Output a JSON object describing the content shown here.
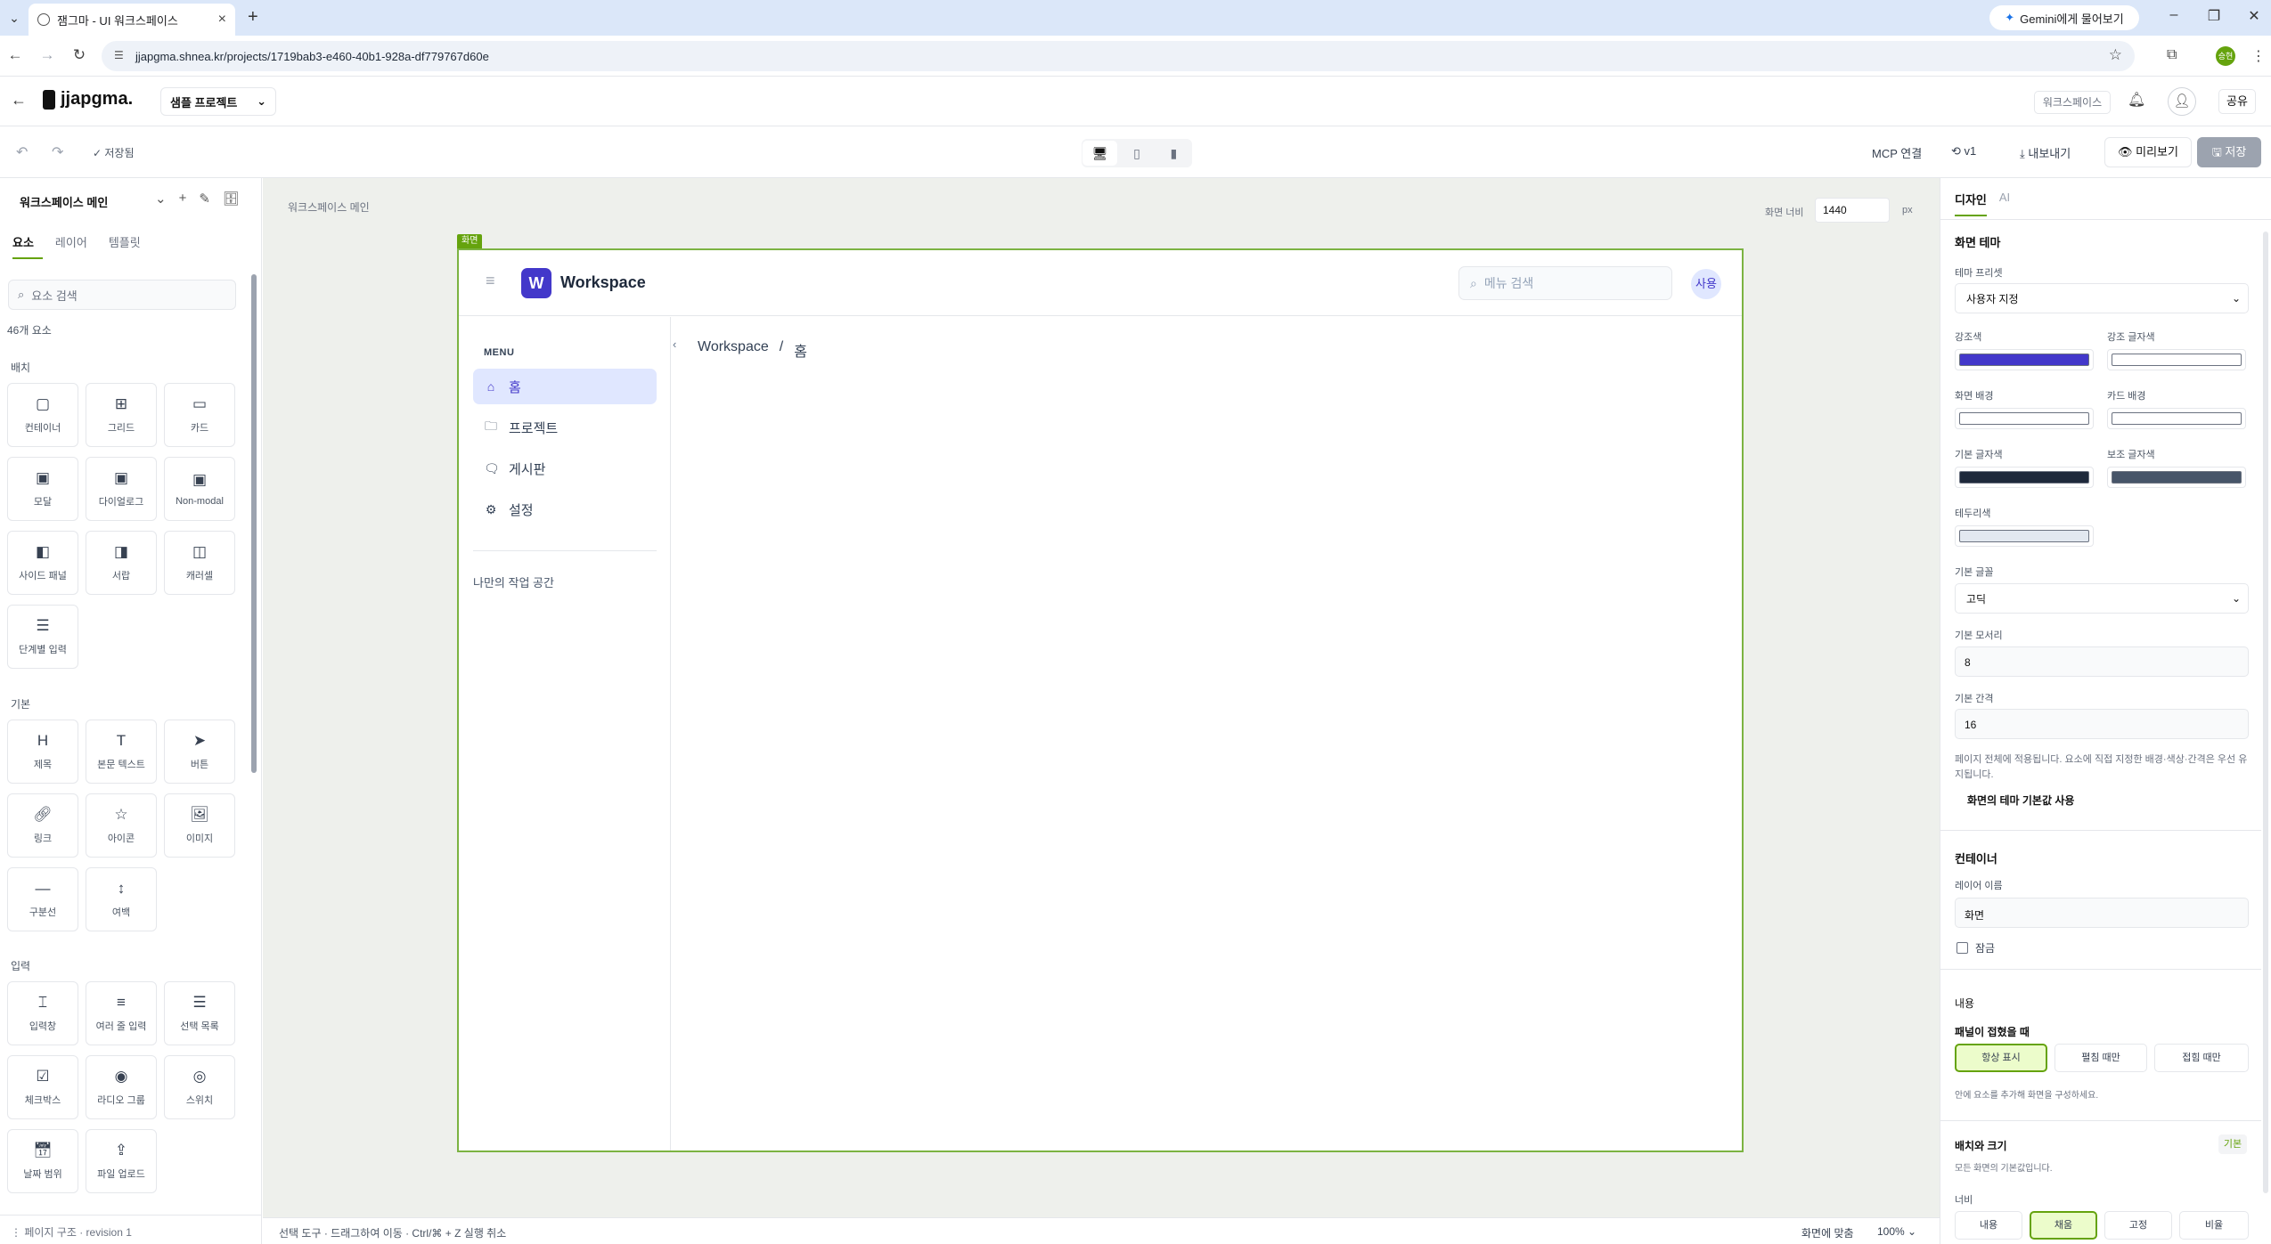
{
  "browser": {
    "tab_title": "잼그마 - UI 워크스페이스",
    "gemini_label": "Gemini에게 물어보기",
    "url": "jjapgma.shnea.kr/projects/1719bab3-e460-40b1-928a-df779767d60e",
    "profile_label": "승현"
  },
  "header": {
    "logo_text": "jjapgma.",
    "project": "샘플 프로젝트",
    "workspace_btn": "워크스페이스",
    "share": "공유"
  },
  "toolbar": {
    "saved": "✓ 저장됨",
    "mcp": "MCP 연결",
    "version": "v1",
    "export": "내보내기",
    "preview": "미리보기",
    "save": "저장"
  },
  "left_panel": {
    "title": "워크스페이스 메인",
    "tabs": [
      "요소",
      "레이어",
      "템플릿"
    ],
    "search_placeholder": "요소 검색",
    "count": "46개 요소",
    "sections": {
      "layout": "배치",
      "basic": "기본",
      "input": "입력"
    },
    "layout_items": [
      "컨테이너",
      "그리드",
      "카드",
      "모달",
      "다이얼로그",
      "Non-modal",
      "사이드 패널",
      "서랍",
      "캐러셀",
      "단계별 입력"
    ],
    "basic_items": [
      "제목",
      "본문 텍스트",
      "버튼",
      "링크",
      "아이콘",
      "이미지",
      "구분선",
      "여백"
    ],
    "input_items": [
      "입력창",
      "여러 줄 입력",
      "선택 목록",
      "체크박스",
      "라디오 그룹",
      "스위치",
      "날짜 범위",
      "파일 업로드"
    ],
    "footer": "페이지 구조 · revision 1"
  },
  "canvas": {
    "label": "워크스페이스 메인",
    "width_label": "화면 너비",
    "width_value": "1440",
    "px": "px",
    "frame_tag": "화면",
    "status_hint": "선택 도구 · 드래그하여 이동 · Ctrl/⌘ + Z 실행 취소",
    "fit": "화면에 맞춤",
    "zoom": "100%"
  },
  "frame": {
    "logo_letter": "W",
    "brand": "Workspace",
    "search_placeholder": "메뉴 검색",
    "avatar": "사용",
    "menu_title": "MENU",
    "menu": [
      "홈",
      "프로젝트",
      "게시판",
      "설정"
    ],
    "my_work": "나만의 작업 공간",
    "breadcrumb": [
      "Workspace",
      "/",
      "홈"
    ]
  },
  "right_panel": {
    "tabs": [
      "디자인",
      "AI"
    ],
    "theme_title": "화면 테마",
    "preset_label": "테마 프리셋",
    "preset_value": "사용자 지정",
    "colors": [
      {
        "label": "강조색",
        "hex": "#4338ca"
      },
      {
        "label": "강조 글자색",
        "hex": "#ffffff"
      },
      {
        "label": "화면 배경",
        "hex": "#ffffff"
      },
      {
        "label": "카드 배경",
        "hex": "#ffffff"
      },
      {
        "label": "기본 글자색",
        "hex": "#1e293b"
      },
      {
        "label": "보조 글자색",
        "hex": "#475569"
      },
      {
        "label": "테두리색",
        "hex": "#e2e8f0"
      }
    ],
    "font_label": "기본 글꼴",
    "font_value": "고딕",
    "radius_label": "기본 모서리",
    "radius_value": "8",
    "spacing_label": "기본 간격",
    "spacing_value": "16",
    "theme_note": "페이지 전체에 적용됩니다. 요소에 직접 지정한 배경·색상·간격은 우선 유지됩니다.",
    "theme_default": "화면의 테마 기본값 사용",
    "container_title": "컨테이너",
    "layer_name_label": "레이어 이름",
    "layer_name_value": "화면",
    "lock_label": "잠금",
    "content_title": "내용",
    "collapse_label": "패널이 접혔을 때",
    "collapse_opts": [
      "항상 표시",
      "펼침 때만",
      "접힘 때만"
    ],
    "content_note": "안에 요소를 추가해 화면을 구성하세요.",
    "size_title": "배치와 크기",
    "size_badge": "기본",
    "size_note": "모든 화면의 기본값입니다.",
    "width_label": "너비",
    "width_opts": [
      "내용",
      "채움",
      "고정",
      "비율"
    ]
  }
}
